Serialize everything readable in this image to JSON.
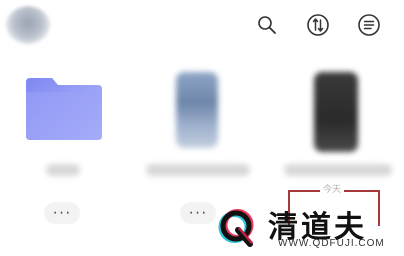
{
  "header": {
    "icons": [
      "search-icon",
      "sort-icon",
      "menu-icon"
    ]
  },
  "items": [
    {
      "type": "folder",
      "more_label": "···"
    },
    {
      "type": "phone-light",
      "more_label": "···"
    },
    {
      "type": "phone-dark"
    }
  ],
  "annotation": {
    "text": "今天"
  },
  "watermark": {
    "brand_name": "清道夫",
    "url": "WWW.QDFUJI.COM",
    "logo_letter": "Q"
  },
  "colors": {
    "folder": "#8e97f5",
    "accent_red": "#e8234a",
    "accent_cyan": "#2cc4d6",
    "annotation_border": "#a63a3a"
  }
}
